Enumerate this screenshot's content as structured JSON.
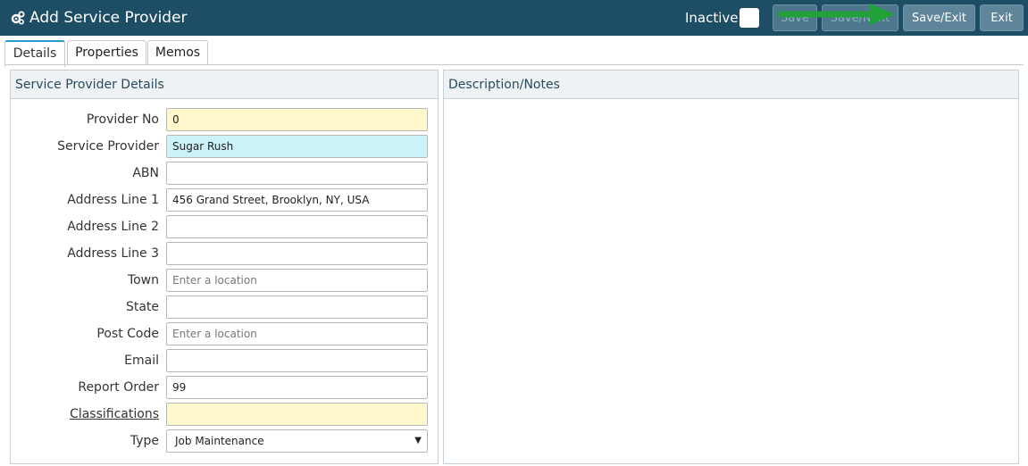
{
  "header": {
    "title": "Add Service Provider",
    "inactive_label": "Inactive",
    "buttons": {
      "save": "Save",
      "save_next": "Save/Next",
      "save_exit": "Save/Exit",
      "exit": "Exit"
    },
    "arrow_color": "#22a03a"
  },
  "tabs": [
    {
      "label": "Details",
      "active": true
    },
    {
      "label": "Properties",
      "active": false
    },
    {
      "label": "Memos",
      "active": false
    }
  ],
  "left_panel": {
    "heading": "Service Provider Details",
    "fields": {
      "provider_no": {
        "label": "Provider No",
        "value": "0"
      },
      "service_provider": {
        "label": "Service Provider",
        "value": "Sugar Rush"
      },
      "abn": {
        "label": "ABN",
        "value": ""
      },
      "address1": {
        "label": "Address Line 1",
        "value": "456 Grand Street, Brooklyn, NY, USA"
      },
      "address2": {
        "label": "Address Line 2",
        "value": ""
      },
      "address3": {
        "label": "Address Line 3",
        "value": ""
      },
      "town": {
        "label": "Town",
        "value": "",
        "placeholder": "Enter a location"
      },
      "state": {
        "label": "State",
        "value": ""
      },
      "post_code": {
        "label": "Post Code",
        "value": "",
        "placeholder": "Enter a location"
      },
      "email": {
        "label": "Email",
        "value": ""
      },
      "report_order": {
        "label": "Report Order",
        "value": "99"
      },
      "classifications": {
        "label": "Classifications",
        "value": ""
      },
      "type": {
        "label": "Type",
        "value": "Job Maintenance"
      }
    }
  },
  "right_panel": {
    "heading": "Description/Notes"
  }
}
